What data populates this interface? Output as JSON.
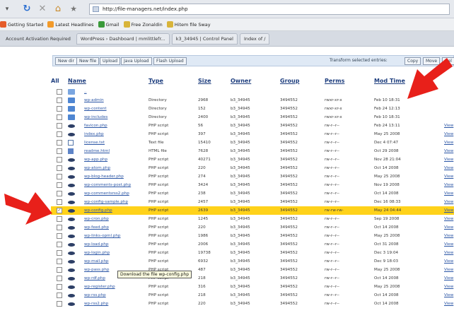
{
  "browser": {
    "url": "http://file-managers.net/index.php",
    "bookmarks": [
      "Getting Started",
      "Latest Headlines",
      "Gmail",
      "Free Zonaldin",
      "Hitem file Sway"
    ],
    "tabs": [
      "Account Activation Required",
      "WordPress › Dashboard | mmlittlefr...",
      "k3_34945 | Control Panel",
      "Index of /"
    ]
  },
  "toolbar": {
    "buttons": [
      "New dir",
      "New file",
      "Upload",
      "Java Upload",
      "Flash Upload"
    ],
    "transform_label": "Transform selected entries:",
    "actions": [
      "Copy",
      "Move",
      "Del"
    ]
  },
  "table": {
    "columns": [
      "All",
      "Name",
      "Type",
      "Size",
      "Owner",
      "Group",
      "Perms",
      "Mod Time"
    ],
    "rows": [
      {
        "icon": "up",
        "name": "..",
        "type": "",
        "size": "",
        "owner": "",
        "group": "",
        "perms": "",
        "mod": "",
        "view": ""
      },
      {
        "icon": "dir",
        "name": "wp-admin",
        "type": "Directory",
        "size": "2968",
        "owner": "b3_34945",
        "group": "3494552",
        "perms": "rwxr-xr-x",
        "mod": "Feb 10 18:31",
        "view": ""
      },
      {
        "icon": "dir",
        "name": "wp-content",
        "type": "Directory",
        "size": "152",
        "owner": "b3_34945",
        "group": "3494552",
        "perms": "rwxr-xr-x",
        "mod": "Feb 24 12:13",
        "view": ""
      },
      {
        "icon": "dir",
        "name": "wp-includes",
        "type": "Directory",
        "size": "2400",
        "owner": "b3_34945",
        "group": "3494552",
        "perms": "rwxr-xr-x",
        "mod": "Feb 10 18:31",
        "view": ""
      },
      {
        "icon": "php",
        "name": "favicon.php",
        "type": "PHP script",
        "size": "56",
        "owner": "b3_34945",
        "group": "3494552",
        "perms": "rw-r--r--",
        "mod": "Feb 24 13:11",
        "view": "View"
      },
      {
        "icon": "php",
        "name": "index.php",
        "type": "PHP script",
        "size": "397",
        "owner": "b3_34945",
        "group": "3494552",
        "perms": "rw-r--r--",
        "mod": "May 25 2008",
        "view": "View"
      },
      {
        "icon": "txt",
        "name": "license.txt",
        "type": "Text file",
        "size": "15410",
        "owner": "b3_34945",
        "group": "3494552",
        "perms": "rw-r--r--",
        "mod": "Dec 4 07:47",
        "view": "View"
      },
      {
        "icon": "htm",
        "name": "readme.html",
        "type": "HTML file",
        "size": "7628",
        "owner": "b3_34945",
        "group": "3494552",
        "perms": "rw-r--r--",
        "mod": "Oct 29 2008",
        "view": "View"
      },
      {
        "icon": "php",
        "name": "wp-app.php",
        "type": "PHP script",
        "size": "40271",
        "owner": "b3_34945",
        "group": "3494552",
        "perms": "rw-r--r--",
        "mod": "Nov 28 21:04",
        "view": "View"
      },
      {
        "icon": "php",
        "name": "wp-atom.php",
        "type": "PHP script",
        "size": "220",
        "owner": "b3_34945",
        "group": "3494552",
        "perms": "rw-r--r--",
        "mod": "Oct 14 2008",
        "view": "View"
      },
      {
        "icon": "php",
        "name": "wp-blog-header.php",
        "type": "PHP script",
        "size": "274",
        "owner": "b3_34945",
        "group": "3494552",
        "perms": "rw-r--r--",
        "mod": "May 25 2008",
        "view": "View"
      },
      {
        "icon": "php",
        "name": "wp-comments-post.php",
        "type": "PHP script",
        "size": "3424",
        "owner": "b3_34945",
        "group": "3494552",
        "perms": "rw-r--r--",
        "mod": "Nov 19 2008",
        "view": "View"
      },
      {
        "icon": "php",
        "name": "wp-commentsrss2.php",
        "type": "PHP script",
        "size": "238",
        "owner": "b3_34945",
        "group": "3494552",
        "perms": "rw-r--r--",
        "mod": "Oct 14 2008",
        "view": "View"
      },
      {
        "icon": "php",
        "name": "wp-config-sample.php",
        "type": "PHP script",
        "size": "2457",
        "owner": "b3_34945",
        "group": "3494552",
        "perms": "rw-r--r--",
        "mod": "Dec 16 08:33",
        "view": "View"
      },
      {
        "icon": "php",
        "name": "wp-config.php",
        "type": "PHP script",
        "size": "2639",
        "owner": "b3_34945",
        "group": "3494552",
        "perms": "rw-rw-rw-",
        "mod": "May 24 04:44",
        "view": "View",
        "highlight": true
      },
      {
        "icon": "php",
        "name": "wp-cron.php",
        "type": "PHP script",
        "size": "1245",
        "owner": "b3_34945",
        "group": "3494552",
        "perms": "rw-r--r--",
        "mod": "Sep 19 2008",
        "view": "View"
      },
      {
        "icon": "php",
        "name": "wp-feed.php",
        "type": "PHP script",
        "size": "220",
        "owner": "b3_34945",
        "group": "3494552",
        "perms": "rw-r--r--",
        "mod": "Oct 14 2008",
        "view": "View"
      },
      {
        "icon": "php",
        "name": "wp-links-opml.php",
        "type": "PHP script",
        "size": "1986",
        "owner": "b3_34945",
        "group": "3494552",
        "perms": "rw-r--r--",
        "mod": "May 25 2008",
        "view": "View"
      },
      {
        "icon": "php",
        "name": "wp-load.php",
        "type": "PHP script",
        "size": "2006",
        "owner": "b3_34945",
        "group": "3494552",
        "perms": "rw-r--r--",
        "mod": "Oct 31 2008",
        "view": "View"
      },
      {
        "icon": "php",
        "name": "wp-login.php",
        "type": "PHP script",
        "size": "19738",
        "owner": "b3_34945",
        "group": "3494552",
        "perms": "rw-r--r--",
        "mod": "Dec 3 19:04",
        "view": "View"
      },
      {
        "icon": "php",
        "name": "wp-mail.php",
        "type": "PHP script",
        "size": "6932",
        "owner": "b3_34945",
        "group": "3494552",
        "perms": "rw-r--r--",
        "mod": "Dec 9 18:03",
        "view": "View"
      },
      {
        "icon": "php",
        "name": "wp-pass.php",
        "type": "PHP script",
        "size": "487",
        "owner": "b3_34945",
        "group": "3494552",
        "perms": "rw-r--r--",
        "mod": "May 25 2008",
        "view": "View"
      },
      {
        "icon": "php",
        "name": "wp-rdf.php",
        "type": "PHP script",
        "size": "218",
        "owner": "b3_34945",
        "group": "3494552",
        "perms": "rw-r--r--",
        "mod": "Oct 14 2008",
        "view": "View"
      },
      {
        "icon": "php",
        "name": "wp-register.php",
        "type": "PHP script",
        "size": "316",
        "owner": "b3_34945",
        "group": "3494552",
        "perms": "rw-r--r--",
        "mod": "May 25 2008",
        "view": "View"
      },
      {
        "icon": "php",
        "name": "wp-rss.php",
        "type": "PHP script",
        "size": "218",
        "owner": "b3_34945",
        "group": "3494552",
        "perms": "rw-r--r--",
        "mod": "Oct 14 2008",
        "view": "View"
      },
      {
        "icon": "php",
        "name": "wp-rss2.php",
        "type": "PHP script",
        "size": "220",
        "owner": "b3_34945",
        "group": "3494552",
        "perms": "rw-r--r--",
        "mod": "Oct 14 2008",
        "view": "View"
      }
    ]
  },
  "tooltip": "Download the file wp-config.php",
  "colors": {
    "highlight": "#ffd21a",
    "arrow": "#e8201a",
    "link": "#2a55a5"
  }
}
